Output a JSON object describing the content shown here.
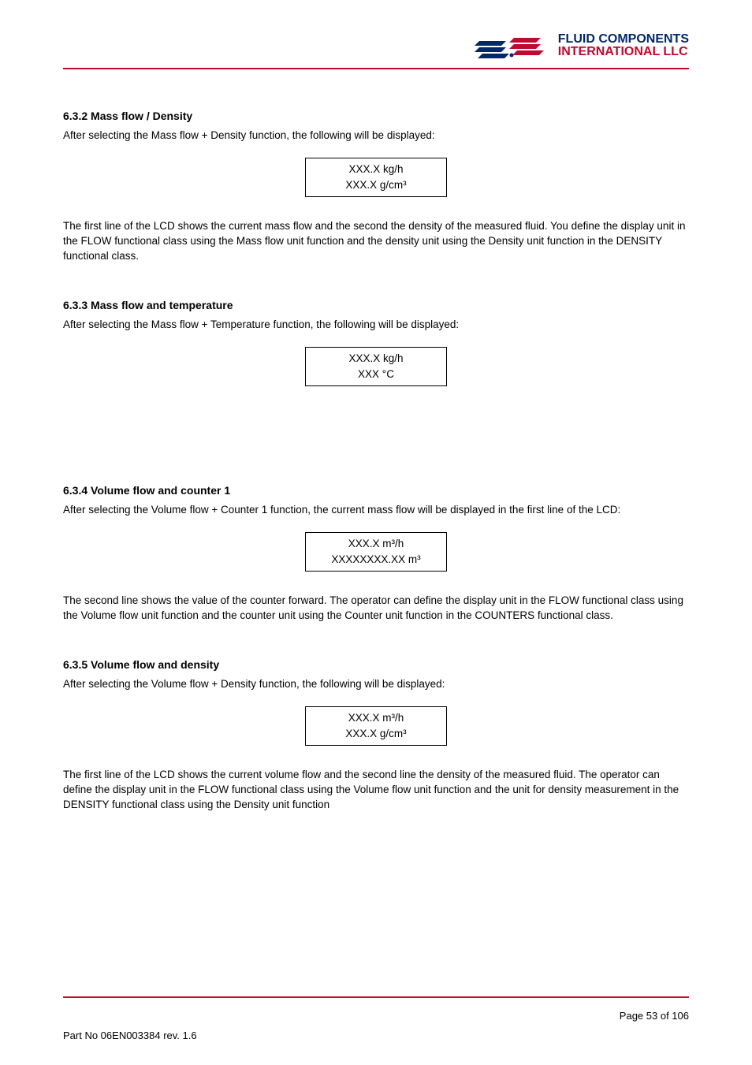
{
  "logo": {
    "line1": "FLUID COMPONENTS",
    "line2": "INTERNATIONAL LLC"
  },
  "section1": {
    "heading": "6.3.2 Mass flow / Density",
    "intro": "After selecting the Mass flow + Density function, the following will be displayed:",
    "display": {
      "line1": "XXX.X kg/h",
      "line2": "XXX.X g/cm³"
    },
    "desc": "The first line of the LCD shows the current mass flow and the second the density of the measured fluid. You define the display unit in the FLOW functional class using the Mass flow unit function and the density unit using the Density unit function in the DENSITY functional class."
  },
  "section2": {
    "heading": "6.3.3 Mass flow and temperature",
    "intro": "After selecting the Mass flow + Temperature function, the following will be displayed:",
    "display": {
      "line1": "XXX.X kg/h",
      "line2": "XXX °C"
    }
  },
  "section3": {
    "heading": "6.3.4 Volume flow and counter 1",
    "intro": "After selecting the Volume flow + Counter 1 function, the current mass flow will be displayed in the first line of the LCD:",
    "display": {
      "line1": "XXX.X m³/h",
      "line2": "XXXXXXXX.XX m³"
    },
    "desc": "The second line shows the value of the counter forward. The operator can define the display unit in the FLOW functional class using the Volume flow unit function and the counter unit using the Counter unit function in the COUNTERS functional class."
  },
  "section4": {
    "heading": "6.3.5 Volume flow and density",
    "intro": "After selecting the Volume flow + Density function, the following will be displayed:",
    "display": {
      "line1": "XXX.X m³/h",
      "line2": "XXX.X g/cm³"
    },
    "desc": "The first line of the LCD shows the current volume flow and the second line the density of the measured fluid. The operator can define the display unit in the FLOW functional class using the Volume flow unit function and the unit for density measurement in the DENSITY functional class using the Density unit function"
  },
  "footer": {
    "pageNumber": "Page 53 of 106",
    "partNo": "Part No 06EN003384 rev. 1.6"
  }
}
